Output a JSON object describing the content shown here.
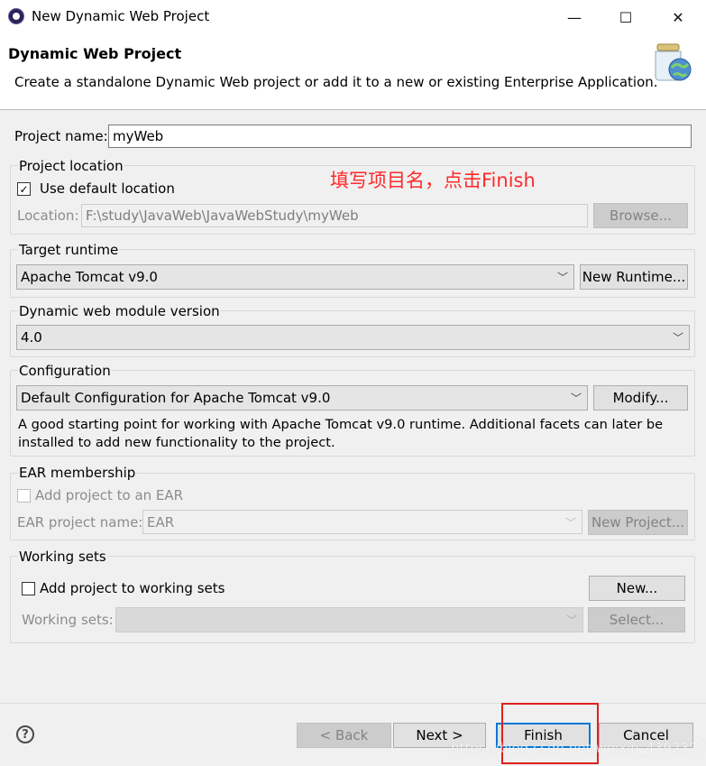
{
  "window": {
    "title": "New Dynamic Web Project",
    "minimize_glyph": "—",
    "maximize_glyph": "☐",
    "close_glyph": "✕"
  },
  "header": {
    "title": "Dynamic Web Project",
    "description": "Create a standalone Dynamic Web project or add it to a new or existing Enterprise Application.",
    "icon": "web-project-jar-globe-icon"
  },
  "project_name": {
    "label": "Project name:",
    "value": "myWeb"
  },
  "project_location": {
    "group_label": "Project location",
    "use_default_label": "Use default location",
    "use_default_checked": true,
    "location_label": "Location:",
    "location_value": "F:\\study\\JavaWeb\\JavaWebStudy\\myWeb",
    "browse_label": "Browse..."
  },
  "annotation": "填写项目名，点击Finish",
  "target_runtime": {
    "group_label": "Target runtime",
    "selected": "Apache Tomcat v9.0",
    "new_runtime_label": "New Runtime..."
  },
  "module_version": {
    "group_label": "Dynamic web module version",
    "selected": "4.0"
  },
  "configuration": {
    "group_label": "Configuration",
    "selected": "Default Configuration for Apache Tomcat v9.0",
    "modify_label": "Modify...",
    "description_line1": "A good starting point for working with Apache Tomcat v9.0 runtime. Additional facets can later be",
    "description_line2": "installed to add new functionality to the project."
  },
  "ear": {
    "group_label": "EAR membership",
    "add_label": "Add project to an EAR",
    "add_checked": false,
    "name_label": "EAR project name:",
    "name_value": "EAR",
    "new_project_label": "New Project..."
  },
  "working_sets": {
    "group_label": "Working sets",
    "add_label": "Add project to working sets",
    "add_checked": false,
    "new_label": "New...",
    "sets_label": "Working sets:",
    "select_label": "Select..."
  },
  "footer": {
    "help_glyph": "?",
    "back_label": "< Back",
    "next_label": "Next >",
    "finish_label": "Finish",
    "cancel_label": "Cancel"
  },
  "watermark": "https://blog.csdn.net/weixin_43923774",
  "colors": {
    "annotation": "#ff2a2a",
    "highlight_box": "#e02020",
    "default_button_border": "#0078d7"
  }
}
